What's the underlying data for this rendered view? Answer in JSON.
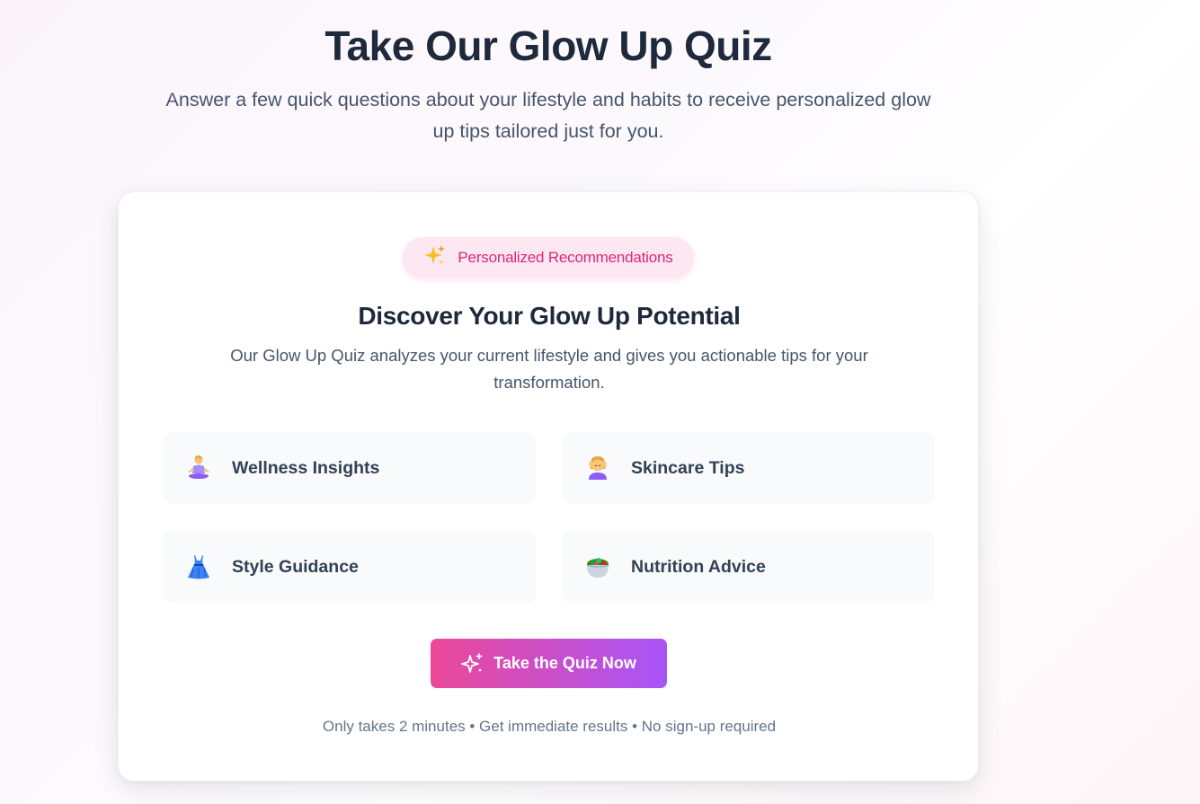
{
  "hero": {
    "title": "Take Our Glow Up Quiz",
    "subtitle": "Answer a few quick questions about your lifestyle and habits to receive personalized glow up tips tailored just for you."
  },
  "card": {
    "badge": {
      "icon": "sparkles-icon",
      "text": "Personalized Recommendations"
    },
    "title": "Discover Your Glow Up Potential",
    "description": "Our Glow Up Quiz analyzes your current lifestyle and gives you actionable tips for your transformation.",
    "features": [
      {
        "icon": "meditation-icon",
        "label": "Wellness Insights"
      },
      {
        "icon": "face-massage-icon",
        "label": "Skincare Tips"
      },
      {
        "icon": "dress-icon",
        "label": "Style Guidance"
      },
      {
        "icon": "salad-icon",
        "label": "Nutrition Advice"
      }
    ],
    "cta": {
      "icon": "sparkle-outline-icon",
      "label": "Take the Quiz Now"
    },
    "footnote": "Only takes 2 minutes • Get immediate results • No sign-up required"
  },
  "colors": {
    "accent_pink": "#ec4899",
    "accent_purple": "#a855f7",
    "badge_bg": "#fce7f3",
    "badge_text": "#db2777",
    "heading": "#1e293b",
    "body_text": "#475569"
  }
}
